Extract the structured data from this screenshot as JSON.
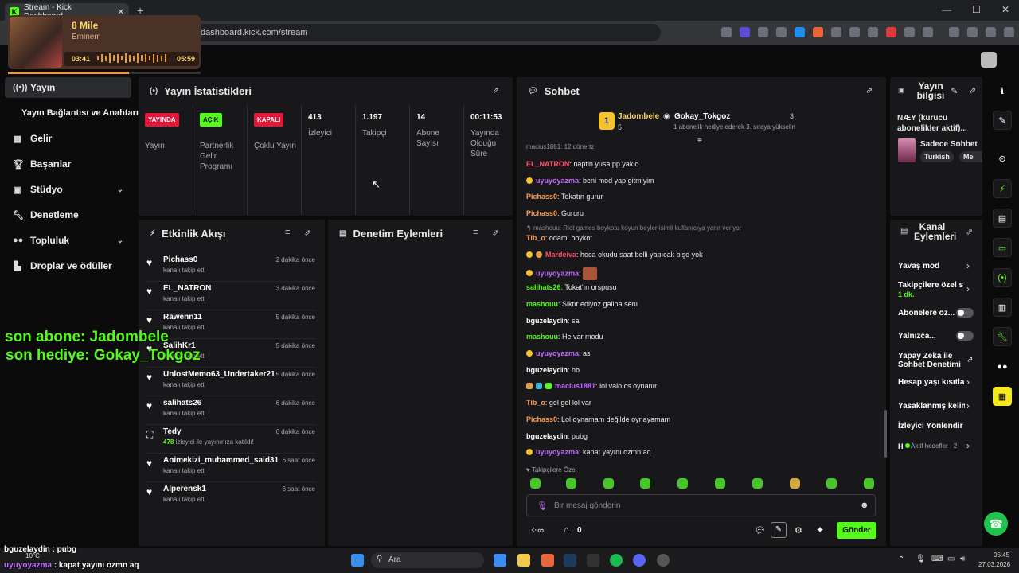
{
  "browser": {
    "tab_title": "Stream - Kick Dashboard",
    "new_tab": "+",
    "url": "dashboard.kick.com/stream",
    "window_controls": [
      "—",
      "☐",
      "✕"
    ]
  },
  "media_overlay": {
    "song": "8 Mile",
    "artist": "Eminem",
    "elapsed": "03:41",
    "total": "05:59"
  },
  "sidebar": {
    "items": [
      {
        "label": "Yayın",
        "icon": "broadcast-icon"
      },
      {
        "label": "Yayın Bağlantısı ve Anahtarı"
      },
      {
        "label": "Gelir",
        "icon": "income-icon"
      },
      {
        "label": "Başarılar",
        "icon": "trophy-icon"
      },
      {
        "label": "Stüdyo",
        "icon": "studio-icon"
      },
      {
        "label": "Denetleme",
        "icon": "wrench-icon"
      },
      {
        "label": "Topluluk",
        "icon": "community-icon"
      },
      {
        "label": "Droplar ve ödüller",
        "icon": "drops-icon"
      }
    ]
  },
  "stats": {
    "title": "Yayın İstatistikleri",
    "cols": [
      {
        "value": "YAYINDA",
        "label": "Yayın"
      },
      {
        "value": "AÇIK",
        "label": "Partnerlik Gelir Programı"
      },
      {
        "value": "KAPALI",
        "label": "Çoklu Yayın"
      },
      {
        "value": "413",
        "label": "İzleyici"
      },
      {
        "value": "1.197",
        "label": "Takipçi"
      },
      {
        "value": "14",
        "label": "Abone Sayısı"
      },
      {
        "value": "00:11:53",
        "label": "Yayında Olduğu Süre"
      }
    ]
  },
  "activity": {
    "title": "Etkinlik Akışı",
    "items": [
      {
        "name": "Pichass0",
        "sub": "kanalı takip etti",
        "time": "2 dakika önce"
      },
      {
        "name": "EL_NATRON",
        "sub": "kanalı takip etti",
        "time": "3 dakika önce"
      },
      {
        "name": "Rawenn11",
        "sub": "kanalı takip etti",
        "time": "5 dakika önce"
      },
      {
        "name": "SalihKr1",
        "sub": "kanalı takip etti",
        "time": "5 dakika önce"
      },
      {
        "name": "UnlostMemo63_Undertaker21",
        "sub": "kanalı takip etti",
        "time": "5 dakika önce"
      },
      {
        "name": "salihats26",
        "sub": "kanalı takip etti",
        "time": "6 dakika önce"
      },
      {
        "name": "Tedy",
        "sub_num": "478",
        "sub": "izleyici ile yayınınıza katıldı!",
        "time": "6 dakika önce"
      },
      {
        "name": "Animekizi_muhammed_said31",
        "sub": "kanalı takip etti",
        "time": "6 saat önce"
      },
      {
        "name": "Alperensk1",
        "sub": "kanalı takip etti",
        "time": "6 saat önce"
      }
    ]
  },
  "moderation": {
    "title": "Denetim Eylemleri"
  },
  "chat": {
    "title": "Sohbet",
    "leader": {
      "rank": "1",
      "user": "Jadombele",
      "count": "5",
      "gifter": "Gokay_Tokgoz",
      "gifter_count": "3",
      "note": "1 abonelik hediye ederek 3. sıraya yükselin"
    },
    "partial_top": "macius1881: 12 dönertz",
    "messages": [
      {
        "user": "EL_NATRON",
        "text": "naptin yusa pp yakio"
      },
      {
        "user": "uyuyoyazma",
        "text": "beni mod yap gitmiyim"
      },
      {
        "user": "Pichass0",
        "text": "Tokatın gurur"
      },
      {
        "user": "Pichass0",
        "text": "Gururu"
      },
      {
        "reply": "mashouu: Riot games boykotu koyun beyler isimli kullanıcıya yanıt veriyor",
        "user": "Tib_o",
        "text": "odamı boykot"
      },
      {
        "user": "Mardeiva",
        "text": "hoca okudu saat belli yapıcak bişe yok"
      },
      {
        "user": "uyuyoyazma",
        "text": ""
      },
      {
        "user": "salihats26",
        "text": "Tokat'ın orspusu"
      },
      {
        "user": "mashouu",
        "text": "Siktır ediyoz galiba senı"
      },
      {
        "user": "bguzelaydin",
        "text": "sa"
      },
      {
        "user": "mashouu",
        "text": "He var modu"
      },
      {
        "user": "uyuyoyazma",
        "text": "as"
      },
      {
        "user": "bguzelaydin",
        "text": "hb"
      },
      {
        "user": "macius1881",
        "text": "lol valo cs oynanır"
      },
      {
        "user": "Tib_o",
        "text": "gel gel lol var"
      },
      {
        "user": "Pichass0",
        "text": "Lol oynamam değilde oynayamam"
      },
      {
        "user": "bguzelaydin",
        "text": "pubg"
      },
      {
        "user": "uyuyoyazma",
        "text": "kapat yayını ozmn aq"
      }
    ],
    "followers_only": "Takipçilere Özel",
    "input_placeholder": "Bir mesaj gönderin",
    "points": "0",
    "send": "Gönder"
  },
  "stream_info": {
    "title": "Yayın bilgisi",
    "desc": "NÆY (kurucu abonelikler aktif)...",
    "category": "Sadece Sohbet",
    "tags": [
      "Turkish",
      "Me"
    ]
  },
  "channel_actions": {
    "title": "Kanal Eylemleri",
    "items": [
      {
        "label": "Yavaş mod",
        "type": "chev"
      },
      {
        "label": "Takipçilere özel so",
        "sub": "1 dk.",
        "type": "chev"
      },
      {
        "label": "Abonelere öz...",
        "type": "toggle"
      },
      {
        "label": "Yalnızca...",
        "type": "toggle"
      },
      {
        "label": "Yapay Zeka ile Sohbet Denetimi",
        "type": "link"
      },
      {
        "label": "Hesap yaşı kısıtla",
        "type": "chev"
      },
      {
        "label": "Yasaklanmış kelim",
        "type": "chev"
      },
      {
        "label": "İzleyici Yönlendir",
        "type": "none"
      },
      {
        "label": "Aktif hedefler - 2",
        "prefix": "H",
        "type": "chev"
      }
    ]
  },
  "overlay": {
    "last_sub": "son abone: Jadombele",
    "last_gift": "son hediye: Gokay_Tokgoz",
    "chat1": "bguzelaydin : pubg",
    "chat2_user": "uyuyoyazma",
    "chat2_text": ": kapat yayını ozmn aq"
  },
  "taskbar": {
    "weather": "10°C",
    "search": "Ara",
    "time": "05:45",
    "date": "27.03.2026"
  },
  "colors": {
    "accent": "#53fc18",
    "live": "#e5163a",
    "panel": "#18181b"
  }
}
